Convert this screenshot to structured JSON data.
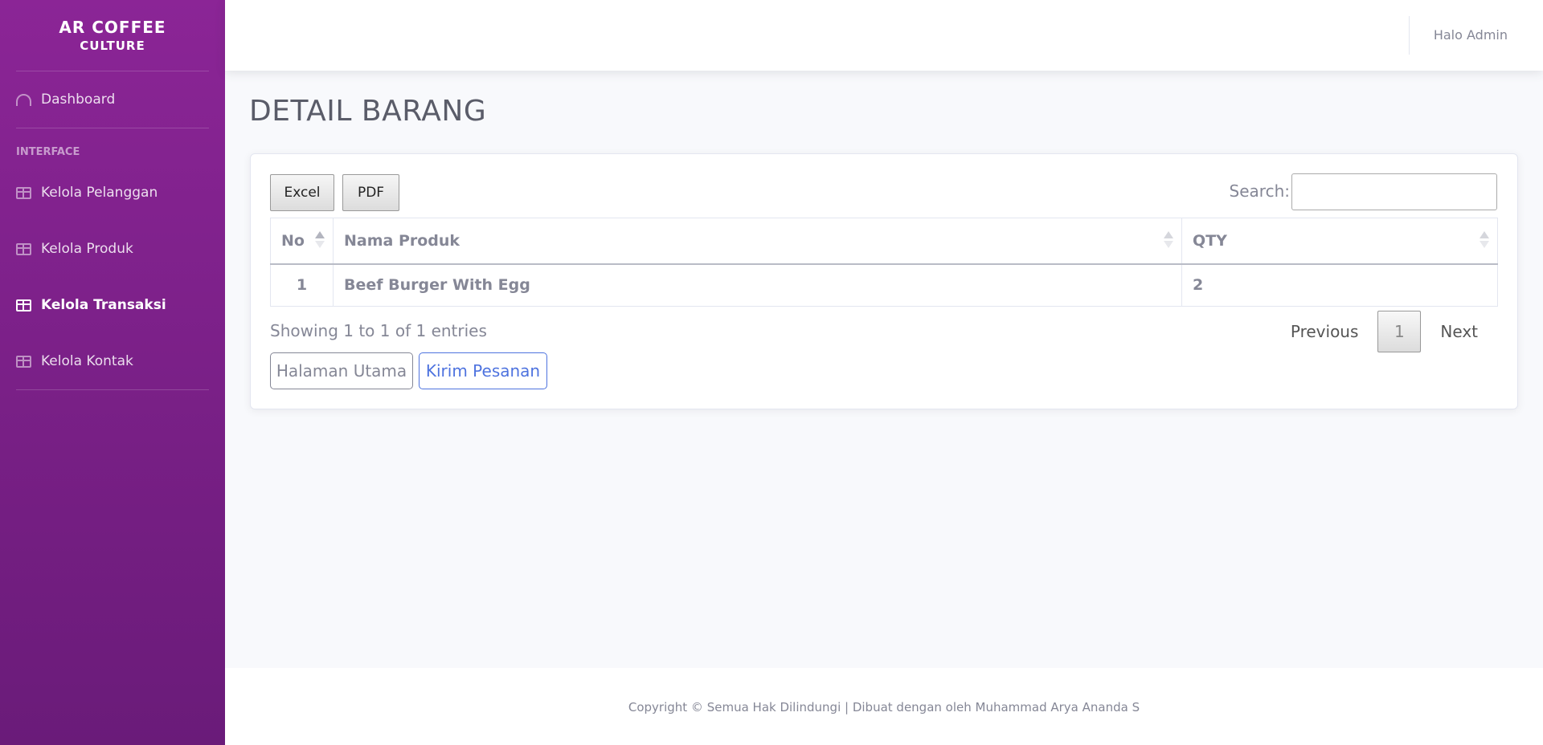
{
  "sidebar": {
    "brand_line1": "AR COFFEE",
    "brand_line2": "CULTURE",
    "dashboard_label": "Dashboard",
    "heading": "INTERFACE",
    "items": [
      {
        "label": "Kelola Pelanggan",
        "icon": "table-icon"
      },
      {
        "label": "Kelola Produk",
        "icon": "table-icon"
      },
      {
        "label": "Kelola Transaksi",
        "icon": "table-icon",
        "active": true
      },
      {
        "label": "Kelola Kontak",
        "icon": "table-icon"
      }
    ]
  },
  "topbar": {
    "user_greeting": "Halo Admin"
  },
  "main": {
    "title": "DETAIL BARANG",
    "export_buttons": {
      "excel": "Excel",
      "pdf": "PDF"
    },
    "search": {
      "label": "Search:",
      "value": ""
    },
    "table": {
      "columns": [
        "No",
        "Nama Produk",
        "QTY"
      ],
      "rows": [
        [
          "1",
          "Beef Burger With Egg",
          "2"
        ]
      ]
    },
    "info": "Showing 1 to 1 of 1 entries",
    "pagination": {
      "previous": "Previous",
      "current_page": "1",
      "next": "Next"
    },
    "actions": {
      "home": "Halaman Utama",
      "send": "Kirim Pesanan"
    }
  },
  "footer": {
    "copyright": "Copyright © Semua Hak Dilindungi | Dibuat dengan oleh Muhammad Arya Ananda S"
  },
  "colors": {
    "sidebar_top": "#8b2596",
    "sidebar_bottom": "#6a1b79",
    "primary": "#4e73df",
    "text_muted": "#858796"
  }
}
